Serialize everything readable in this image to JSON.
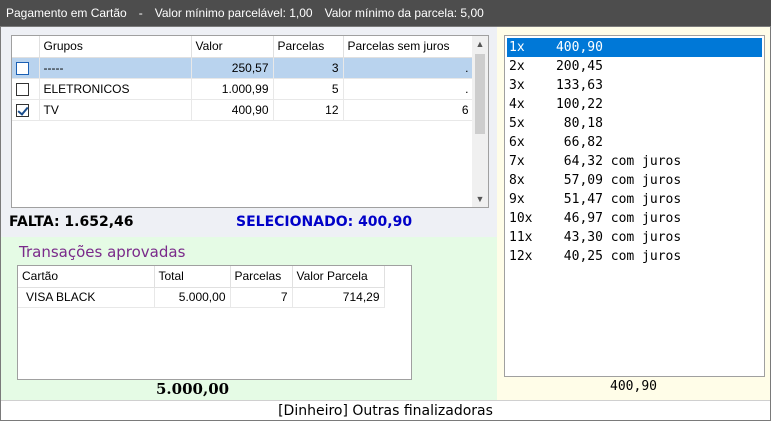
{
  "title": {
    "app": "Pagamento em Cartão",
    "separator": "-",
    "min_parcelavel": "Valor mínimo parcelável: 1,00",
    "min_parcela": "Valor mínimo da parcela: 5,00"
  },
  "groups_grid": {
    "headers": [
      "Grupos",
      "Valor",
      "Parcelas",
      "Parcelas sem juros"
    ],
    "rows": [
      {
        "checked": false,
        "selected": true,
        "grupo": "-----",
        "valor": "250,57",
        "parcelas": "3",
        "sem_juros": "."
      },
      {
        "checked": false,
        "selected": false,
        "grupo": "ELETRONICOS",
        "valor": "1.000,99",
        "parcelas": "5",
        "sem_juros": "."
      },
      {
        "checked": true,
        "selected": false,
        "grupo": "TV",
        "valor": "400,90",
        "parcelas": "12",
        "sem_juros": "6"
      }
    ]
  },
  "summary": {
    "falta": "FALTA: 1.652,46",
    "selecionado": "SELECIONADO: 400,90"
  },
  "transacoes": {
    "title": "Transações aprovadas",
    "headers": [
      "Cartão",
      "Total",
      "Parcelas",
      "Valor Parcela"
    ],
    "rows": [
      {
        "cartao": "VISA BLACK",
        "total": "5.000,00",
        "parcelas": "7",
        "valor_parcela": "714,29"
      }
    ],
    "total": "5.000,00"
  },
  "parcelas_options": [
    "1x    400,90",
    "2x    200,45",
    "3x    133,63",
    "4x    100,22",
    "5x     80,18",
    "6x     66,82",
    "7x     64,32 com juros",
    "8x     57,09 com juros",
    "9x     51,47 com juros",
    "10x    46,97 com juros",
    "11x    43,30 com juros",
    "12x    40,25 com juros"
  ],
  "right_total": "400,90",
  "footer": "[Dinheiro] Outras finalizadoras",
  "colors": {
    "selecionado": "#0000c8",
    "trans_title": "#7a2a8a",
    "list_selection": "#0078d7",
    "grid_selection": "#b9d3ee"
  }
}
